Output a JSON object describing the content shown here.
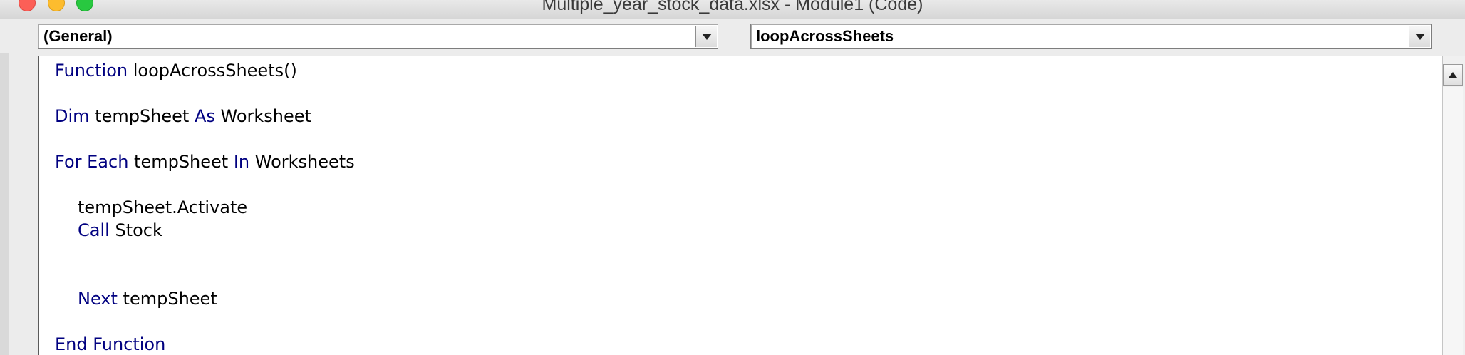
{
  "window": {
    "title": "Multiple_year_stock_data.xlsx - Module1 (Code)"
  },
  "combos": {
    "object_value": "(General)",
    "procedure_value": "loopAcrossSheets"
  },
  "code": {
    "l1": {
      "kw": "Function",
      "rest": " loopAcrossSheets()"
    },
    "l2": {
      "kw1": "Dim",
      "mid": " tempSheet ",
      "kw2": "As",
      "rest": " Worksheet"
    },
    "l3": {
      "kw": "For Each",
      "mid": " tempSheet ",
      "kw2": "In",
      "rest": " Worksheets"
    },
    "l4": {
      "text": "tempSheet.Activate"
    },
    "l5": {
      "kw": "Call",
      "rest": " Stock"
    },
    "l6": {
      "kw": "Next",
      "rest": " tempSheet"
    },
    "l7": {
      "kw": "End Function"
    }
  },
  "colors": {
    "keyword": "#000080",
    "identifier": "#000000",
    "close_button": "#fc5f57",
    "minimize_button": "#fdbc2e",
    "zoom_button": "#28c840"
  },
  "icons": {
    "close": "close-circle-icon",
    "minimize": "minimize-circle-icon",
    "zoom": "zoom-circle-icon",
    "dropdown": "chevron-down-icon",
    "scroll_up": "arrow-up-icon"
  }
}
